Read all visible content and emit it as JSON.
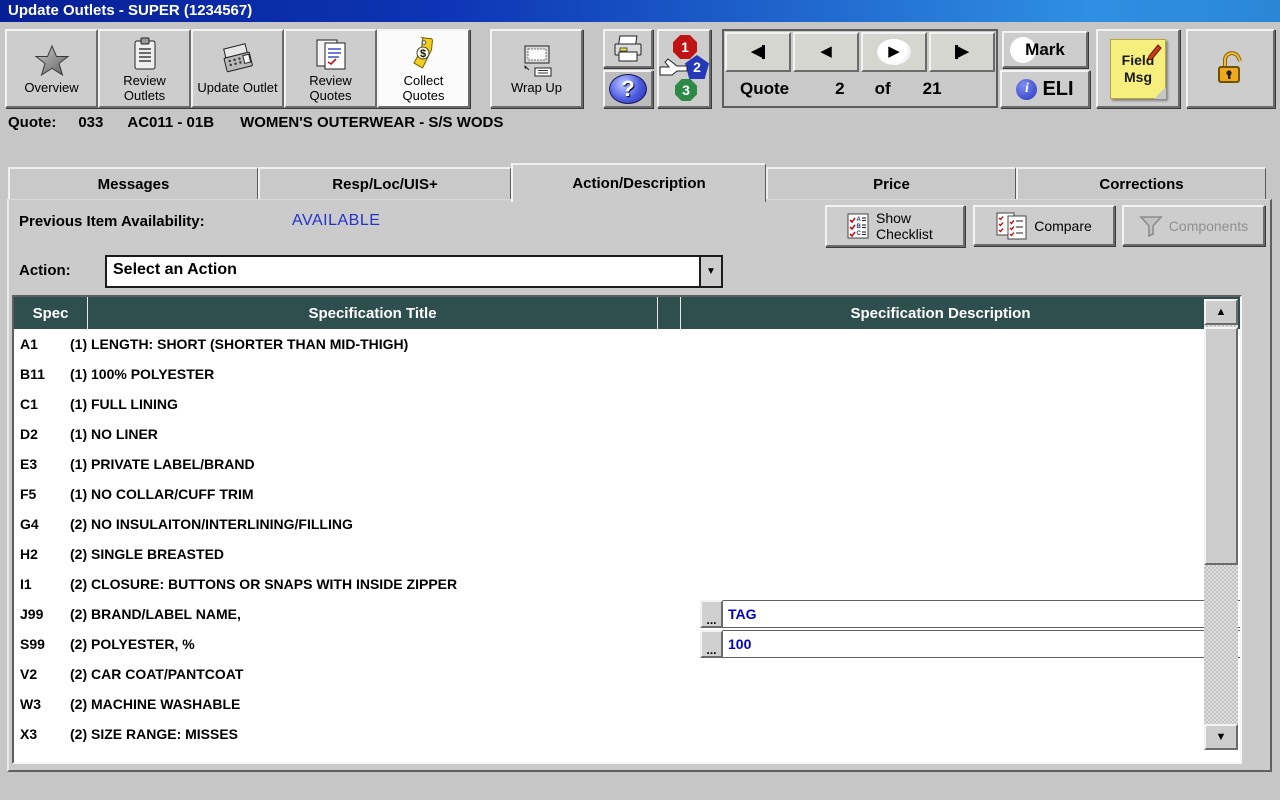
{
  "title_bar": {
    "title": "Update Outlets - SUPER (1234567)"
  },
  "toolbar": {
    "buttons": [
      {
        "label": "Overview",
        "icon": "star-icon"
      },
      {
        "label": "Review Outlets",
        "icon": "clipboard-icon"
      },
      {
        "label": "Update Outlet",
        "icon": "register-icon"
      },
      {
        "label": "Review Quotes",
        "icon": "notes-icon"
      },
      {
        "label": "Collect Quotes",
        "icon": "price-tag-icon",
        "active": true
      },
      {
        "label": "Wrap Up",
        "icon": "computer-icon"
      }
    ],
    "icons": [
      "printer-icon",
      "help-icon",
      "steps-123-icon",
      "unlocked-padlock-icon"
    ],
    "nav": {
      "label": "Quote",
      "current": "2",
      "of": "of",
      "total": "21"
    },
    "mark_label": "Mark",
    "eli_label": "ELI",
    "eli_info_glyph": "i",
    "field_msg": {
      "line1": "Field",
      "line2": "Msg"
    },
    "help_glyph": "?",
    "nav_glyphs": {
      "first": "first-quote",
      "prev": "previous-quote",
      "next": "next-quote",
      "last": "last-quote"
    }
  },
  "quote_line": {
    "label": "Quote:",
    "number": "033",
    "code": "AC011 - 01B",
    "description": "WOMEN'S OUTERWEAR - S/S WODS"
  },
  "tabs": [
    {
      "label": "Messages"
    },
    {
      "label": "Resp/Loc/UIS+"
    },
    {
      "label": "Action/Description",
      "active": true
    },
    {
      "label": "Price"
    },
    {
      "label": "Corrections"
    }
  ],
  "action_tab": {
    "previous_item_label": "Previous Item Availability:",
    "previous_item_value": "AVAILABLE",
    "show_checklist_label": "Show Checklist",
    "compare_label": "Compare",
    "components_label": "Components",
    "action_label": "Action:",
    "action_value": "Select an Action"
  },
  "spec_table": {
    "headers": {
      "spec": "Spec",
      "title": "Specification Title",
      "description": "Specification Description"
    },
    "ellipsis_label": "...",
    "rows": [
      {
        "spec": "A1",
        "title": "(1) LENGTH: SHORT (SHORTER THAN MID-THIGH)"
      },
      {
        "spec": "B11",
        "title": "(1) 100% POLYESTER"
      },
      {
        "spec": "C1",
        "title": "(1) FULL LINING"
      },
      {
        "spec": "D2",
        "title": "(1) NO LINER"
      },
      {
        "spec": "E3",
        "title": "(1) PRIVATE LABEL/BRAND"
      },
      {
        "spec": "F5",
        "title": "(1) NO COLLAR/CUFF TRIM"
      },
      {
        "spec": "G4",
        "title": "(2) NO INSULAITON/INTERLINING/FILLING"
      },
      {
        "spec": "H2",
        "title": "(2) SINGLE BREASTED"
      },
      {
        "spec": "I1",
        "title": "(2) CLOSURE: BUTTONS OR SNAPS WITH INSIDE ZIPPER"
      },
      {
        "spec": "J99",
        "title": "(2) BRAND/LABEL NAME,",
        "description": "TAG"
      },
      {
        "spec": "S99",
        "title": "(2) POLYESTER, %",
        "description": "100"
      },
      {
        "spec": "V2",
        "title": "(2) CAR COAT/PANTCOAT"
      },
      {
        "spec": "W3",
        "title": "(2) MACHINE WASHABLE"
      },
      {
        "spec": "X3",
        "title": "(2) SIZE RANGE: MISSES"
      }
    ]
  },
  "colors": {
    "title_bar_left": "#071f96",
    "title_bar_right": "#2f8fe2",
    "table_header_bg": "#2e4f4e",
    "availability_blue": "#2233cc",
    "value_blue": "#0000cd",
    "window_bg": "#c6c6c6",
    "active_toolbar_button_bg": "#fbfbfb",
    "note_yellow": "#f7ef7d",
    "padlock_orange": "#f0a81c"
  }
}
